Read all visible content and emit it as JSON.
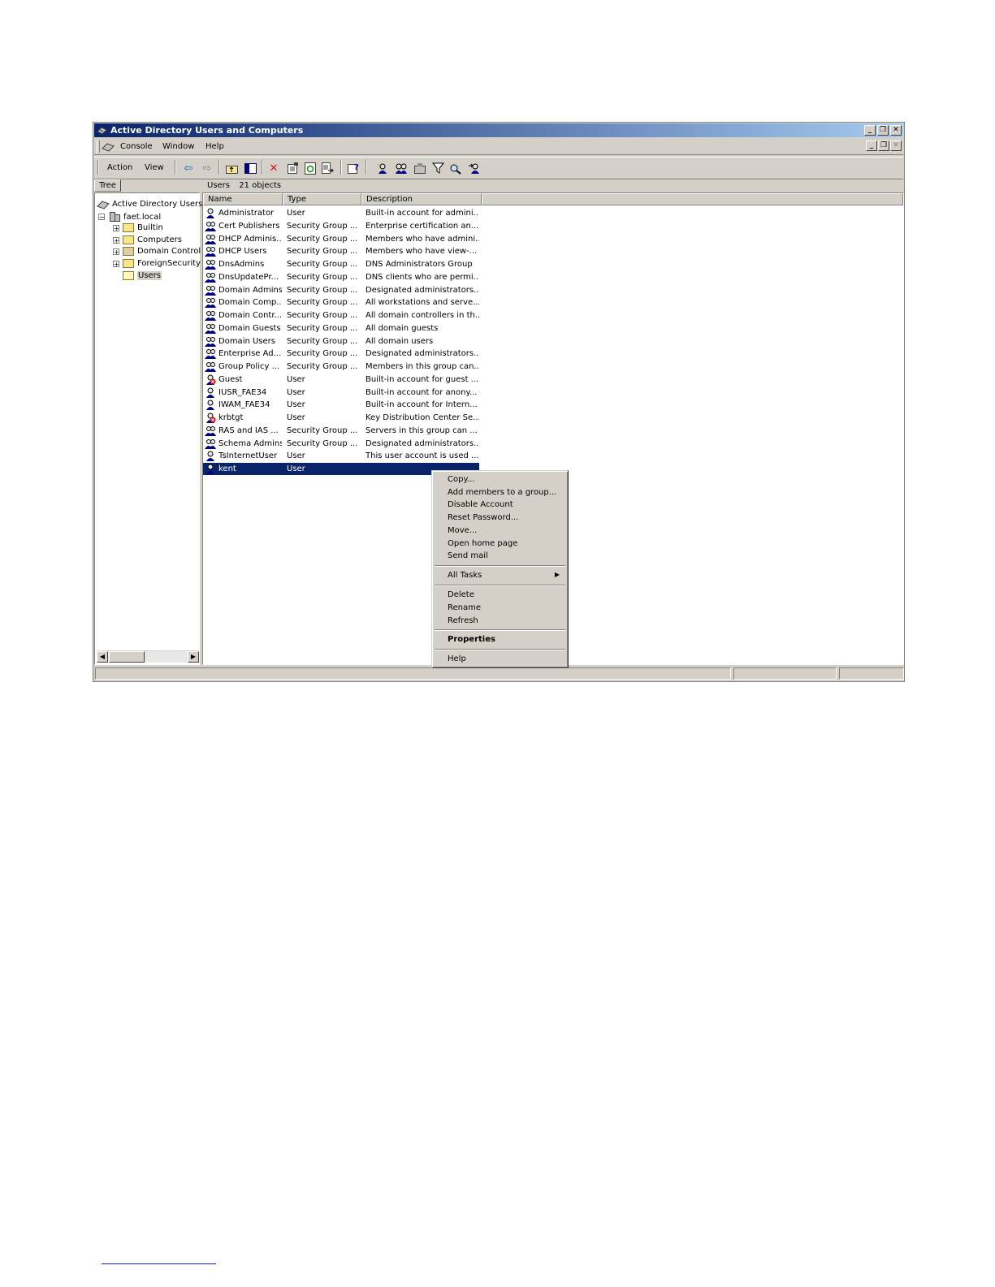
{
  "window": {
    "title": "Active Directory Users and Computers"
  },
  "menubar": {
    "items": [
      "Console",
      "Window",
      "Help"
    ]
  },
  "toolbar": {
    "action_label": "Action",
    "view_label": "View"
  },
  "tree": {
    "tab_label": "Tree",
    "root": "Active Directory Users",
    "domain": "faet.local",
    "children": [
      "Builtin",
      "Computers",
      "Domain Control",
      "ForeignSecurity",
      "Users"
    ]
  },
  "list": {
    "location": "Users",
    "count": "21 objects",
    "columns": [
      "Name",
      "Type",
      "Description"
    ],
    "rows": [
      {
        "name": "Administrator",
        "type": "User",
        "desc": "Built-in account for admini...",
        "icon": "user-icon"
      },
      {
        "name": "Cert Publishers",
        "type": "Security Group ...",
        "desc": "Enterprise certification an...",
        "icon": "group-icon"
      },
      {
        "name": "DHCP Adminis...",
        "type": "Security Group ...",
        "desc": "Members who have admini...",
        "icon": "group-icon"
      },
      {
        "name": "DHCP Users",
        "type": "Security Group ...",
        "desc": "Members who have view-...",
        "icon": "group-icon"
      },
      {
        "name": "DnsAdmins",
        "type": "Security Group ...",
        "desc": "DNS Administrators Group",
        "icon": "group-icon"
      },
      {
        "name": "DnsUpdatePr...",
        "type": "Security Group ...",
        "desc": "DNS clients who are permi...",
        "icon": "group-icon"
      },
      {
        "name": "Domain Admins",
        "type": "Security Group ...",
        "desc": "Designated administrators...",
        "icon": "group-icon"
      },
      {
        "name": "Domain Comp...",
        "type": "Security Group ...",
        "desc": "All workstations and serve...",
        "icon": "group-icon"
      },
      {
        "name": "Domain Contr...",
        "type": "Security Group ...",
        "desc": "All domain controllers in th...",
        "icon": "group-icon"
      },
      {
        "name": "Domain Guests",
        "type": "Security Group ...",
        "desc": "All domain guests",
        "icon": "group-icon"
      },
      {
        "name": "Domain Users",
        "type": "Security Group ...",
        "desc": "All domain users",
        "icon": "group-icon"
      },
      {
        "name": "Enterprise Ad...",
        "type": "Security Group ...",
        "desc": "Designated administrators...",
        "icon": "group-icon"
      },
      {
        "name": "Group Policy ...",
        "type": "Security Group ...",
        "desc": "Members in this group can...",
        "icon": "group-icon"
      },
      {
        "name": "Guest",
        "type": "User",
        "desc": "Built-in account for guest ...",
        "icon": "disabled-user-icon"
      },
      {
        "name": "IUSR_FAE34",
        "type": "User",
        "desc": "Built-in account for anony...",
        "icon": "user-icon"
      },
      {
        "name": "IWAM_FAE34",
        "type": "User",
        "desc": "Built-in account for Intern...",
        "icon": "user-icon"
      },
      {
        "name": "krbtgt",
        "type": "User",
        "desc": "Key Distribution Center Se...",
        "icon": "disabled-user-icon"
      },
      {
        "name": "RAS and IAS ...",
        "type": "Security Group ...",
        "desc": "Servers in this group can ...",
        "icon": "group-icon"
      },
      {
        "name": "Schema Admins",
        "type": "Security Group ...",
        "desc": "Designated administrators...",
        "icon": "group-icon"
      },
      {
        "name": "TsInternetUser",
        "type": "User",
        "desc": "This user account is used ...",
        "icon": "user-icon"
      },
      {
        "name": "kent",
        "type": "User",
        "desc": "",
        "icon": "user-icon",
        "selected": true
      }
    ]
  },
  "context_menu": {
    "group1": [
      "Copy...",
      "Add members to a group...",
      "Disable Account",
      "Reset Password...",
      "Move...",
      "Open home page",
      "Send mail"
    ],
    "all_tasks": "All Tasks",
    "group3": [
      "Delete",
      "Rename",
      "Refresh"
    ],
    "properties": "Properties",
    "help": "Help"
  },
  "colors": {
    "titlebar": "#0a246a",
    "selection": "#0a246a",
    "face": "#d4d0c8"
  }
}
